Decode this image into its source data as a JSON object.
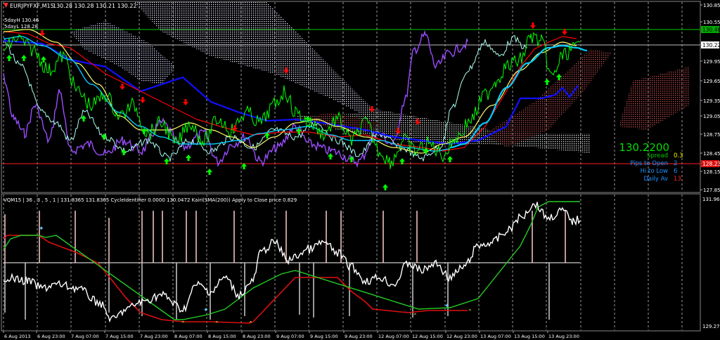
{
  "symbol_header": {
    "title": "EURJPYFXF,M15",
    "ohlc": "130.28 130.28 130.21 130.22"
  },
  "fday": {
    "high": "5dayH 130.46",
    "low": "5dayL 128.28"
  },
  "main_axis": {
    "labels": [
      "130.85",
      "130.55",
      "129.95",
      "129.65",
      "129.35",
      "129.05",
      "128.75",
      "128.45",
      "128.15",
      "127.85"
    ]
  },
  "price_markers": {
    "high": "130.46",
    "current": "130.22",
    "low": "128.23"
  },
  "info_panel": {
    "price": "130.2200",
    "rows": [
      {
        "label": "Spread",
        "value": "0.3",
        "label_color": "#00cc00",
        "value_color": "#ffff00"
      },
      {
        "label": "Pips to Open",
        "value": "2",
        "label_color": "#1e90ff",
        "value_color": "#1e90ff"
      },
      {
        "label": "Hi to Low",
        "value": "6",
        "label_color": "#1e90ff",
        "value_color": "#1e90ff"
      },
      {
        "label": "Daily Av",
        "value": "13",
        "label_color": "#1e90ff",
        "value_color": "#ff2020"
      }
    ]
  },
  "indicator": {
    "title": "VQM15 | 36 , 3 , 5 , 1 | 131.8365 131.8365 CycleIdentifier 0.0000 130.0472 Kairi(SMA(200)) Apply to Close price 0.829",
    "top_label": "131.960",
    "bottom_label": "129.27"
  },
  "time_axis": {
    "labels": [
      "6 Aug 2013",
      "6 Aug 23:00",
      "7 Aug 07:00",
      "7 Aug 15:00",
      "7 Aug 23:00",
      "8 Aug 07:00",
      "8 Aug 15:00",
      "8 Aug 23:00",
      "9 Aug 07:00",
      "9 Aug 15:00",
      "9 Aug 23:00",
      "12 Aug 07:00",
      "12 Aug 15:00",
      "12 Aug 23:00",
      "13 Aug 07:00",
      "13 Aug 15:00",
      "13 Aug 23:00"
    ]
  },
  "colors": {
    "background": "#000000",
    "grid": "#ffffff",
    "price_line": "#00ff00",
    "kijun": "#ff0000",
    "ma_blue": "#1010ff",
    "ma_yellow": "#ffff66",
    "cyan": "#00ccff",
    "purple": "#9b4dff",
    "lightcyan": "#aaffee",
    "cloud_white": "#e6e6ff",
    "cloud_red": "#c05050",
    "up_arrow": "#00ff00",
    "down_arrow": "#ff0000"
  }
}
